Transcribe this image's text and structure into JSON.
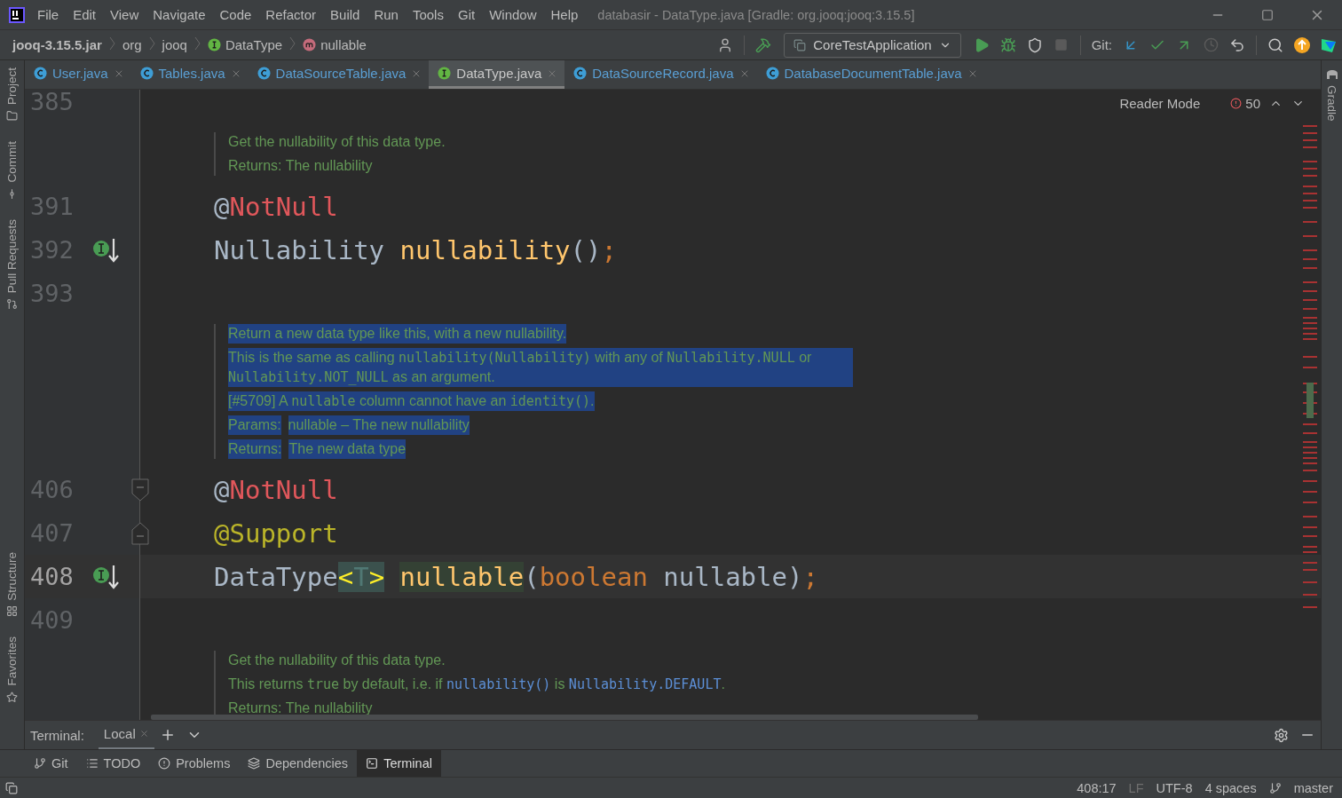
{
  "window": {
    "title": "databasir - DataType.java [Gradle: org.jooq:jooq:3.15.5]"
  },
  "menu": [
    "File",
    "Edit",
    "View",
    "Navigate",
    "Code",
    "Refactor",
    "Build",
    "Run",
    "Tools",
    "Git",
    "Window",
    "Help"
  ],
  "breadcrumbs": [
    {
      "label": "jooq-3.15.5.jar",
      "kind": "jar"
    },
    {
      "label": "org",
      "kind": "package"
    },
    {
      "label": "jooq",
      "kind": "package"
    },
    {
      "label": "DataType",
      "kind": "interface"
    },
    {
      "label": "nullable",
      "kind": "method"
    }
  ],
  "toolbar": {
    "run_config": "CoreTestApplication",
    "git_label": "Git:"
  },
  "left_stripe": [
    {
      "label": "Project",
      "kind": "top"
    },
    {
      "label": "Commit",
      "kind": "top"
    },
    {
      "label": "Pull Requests",
      "kind": "top"
    },
    {
      "label": "Structure",
      "kind": "bottom"
    },
    {
      "label": "Favorites",
      "kind": "bottom"
    }
  ],
  "right_stripe": [
    {
      "label": "Gradle"
    }
  ],
  "tabs": [
    {
      "label": "User.java",
      "kind": "class",
      "selected": false,
      "color": "#5a9fd4"
    },
    {
      "label": "Tables.java",
      "kind": "class",
      "selected": false,
      "color": "#5a9fd4"
    },
    {
      "label": "DataSourceTable.java",
      "kind": "class",
      "selected": false,
      "color": "#5a9fd4"
    },
    {
      "label": "DataType.java",
      "kind": "interface",
      "selected": true,
      "color": "#c8c8c8"
    },
    {
      "label": "DataSourceRecord.java",
      "kind": "class",
      "selected": false,
      "color": "#5a9fd4"
    },
    {
      "label": "DatabaseDocumentTable.java",
      "kind": "class",
      "selected": false,
      "color": "#5a9fd4"
    }
  ],
  "editor": {
    "reader_mode": "Reader Mode",
    "problems": "50",
    "blocks": [
      {
        "kind": "line",
        "number": "385",
        "current": false
      },
      {
        "kind": "doc",
        "selected": false,
        "paragraphs": [
          {
            "kind": "text",
            "segments": [
              {
                "text": "Get the nullability of this data type.",
                "kind": "text"
              }
            ]
          },
          {
            "kind": "text",
            "segments": [
              {
                "text": "Returns: The nullability",
                "kind": "text"
              }
            ]
          }
        ]
      },
      {
        "kind": "line",
        "number": "391",
        "current": false,
        "tokens": [
          {
            "text": "@",
            "kind": "plain"
          },
          {
            "text": "NotNull",
            "kind": "error"
          }
        ]
      },
      {
        "kind": "line",
        "number": "392",
        "current": false,
        "implemented": true,
        "tokens": [
          {
            "text": "Nullability ",
            "kind": "plain"
          },
          {
            "text": "nullability",
            "kind": "method"
          },
          {
            "text": "()",
            "kind": "plain"
          },
          {
            "text": ";",
            "kind": "keyword"
          }
        ]
      },
      {
        "kind": "line",
        "number": "393",
        "current": false
      },
      {
        "kind": "doc",
        "selected": true,
        "paragraphs": [
          {
            "kind": "text",
            "segments": [
              {
                "text": "Return a new data type like this, with a new nullability.",
                "kind": "text"
              }
            ]
          },
          {
            "kind": "text",
            "segments": [
              {
                "text": "This is the same as calling ",
                "kind": "text"
              },
              {
                "text": "nullability(Nullability)",
                "kind": "code"
              },
              {
                "text": " with any of ",
                "kind": "text"
              },
              {
                "text": "Nullability.NULL",
                "kind": "code"
              },
              {
                "text": " or ",
                "kind": "text"
              },
              {
                "text": "Nullability.NOT_NULL",
                "kind": "code"
              },
              {
                "text": " as an argument.",
                "kind": "text"
              }
            ]
          },
          {
            "kind": "text",
            "segments": [
              {
                "text": "[#5709] A ",
                "kind": "text"
              },
              {
                "text": "nullable",
                "kind": "code"
              },
              {
                "text": " column cannot have an ",
                "kind": "text"
              },
              {
                "text": "identity()",
                "kind": "code"
              },
              {
                "text": ".",
                "kind": "text"
              }
            ]
          },
          {
            "kind": "tag",
            "label": "Params:",
            "segments": [
              {
                "text": "nullable – The new nullability",
                "kind": "text"
              }
            ]
          },
          {
            "kind": "tag",
            "label": "Returns:",
            "segments": [
              {
                "text": "The new data type",
                "kind": "text"
              }
            ]
          }
        ]
      },
      {
        "kind": "line",
        "number": "406",
        "current": false,
        "fold_start": true,
        "tokens": [
          {
            "text": "@",
            "kind": "plain"
          },
          {
            "text": "NotNull",
            "kind": "error"
          }
        ]
      },
      {
        "kind": "line",
        "number": "407",
        "current": false,
        "fold_end": true,
        "tokens": [
          {
            "text": "@Support",
            "kind": "annotation"
          }
        ]
      },
      {
        "kind": "line",
        "number": "408",
        "current": true,
        "implemented": true,
        "tokens": [
          {
            "text": "DataType",
            "kind": "plain"
          },
          {
            "text": "<",
            "kind": "bracket"
          },
          {
            "text": "T",
            "kind": "typeparam"
          },
          {
            "text": ">",
            "kind": "bracket"
          },
          {
            "text": "nullable",
            "kind": "methodmatch"
          },
          {
            "text": "(",
            "kind": "plain"
          },
          {
            "text": "boolean",
            "kind": "keyword"
          },
          {
            "text": " nullable)",
            "kind": "plain"
          },
          {
            "text": ";",
            "kind": "keyword"
          }
        ]
      },
      {
        "kind": "line",
        "number": "409",
        "current": false
      },
      {
        "kind": "doc",
        "selected": false,
        "paragraphs": [
          {
            "kind": "text",
            "segments": [
              {
                "text": "Get the nullability of this data type.",
                "kind": "text"
              }
            ]
          },
          {
            "kind": "text",
            "segments": [
              {
                "text": "This returns ",
                "kind": "text"
              },
              {
                "text": "true",
                "kind": "code"
              },
              {
                "text": " by default, i.e. if ",
                "kind": "text"
              },
              {
                "text": "nullability()",
                "kind": "link"
              },
              {
                "text": " is ",
                "kind": "text"
              },
              {
                "text": "Nullability.DEFAULT",
                "kind": "link"
              },
              {
                "text": ".",
                "kind": "text"
              }
            ]
          },
          {
            "kind": "text",
            "segments": [
              {
                "text": "Returns: The nullability",
                "kind": "text"
              }
            ]
          }
        ]
      }
    ]
  },
  "terminal": {
    "label": "Terminal:",
    "tabs": [
      {
        "label": "Local",
        "selected": true
      }
    ]
  },
  "tool_windows": [
    {
      "label": "Git",
      "selected": false
    },
    {
      "label": "TODO",
      "selected": false
    },
    {
      "label": "Problems",
      "selected": false
    },
    {
      "label": "Dependencies",
      "selected": false
    },
    {
      "label": "Terminal",
      "selected": true
    }
  ],
  "status_bar": {
    "position": "408:17",
    "line_separator": "LF",
    "encoding": "UTF-8",
    "indent": "4 spaces",
    "branch": "master"
  }
}
